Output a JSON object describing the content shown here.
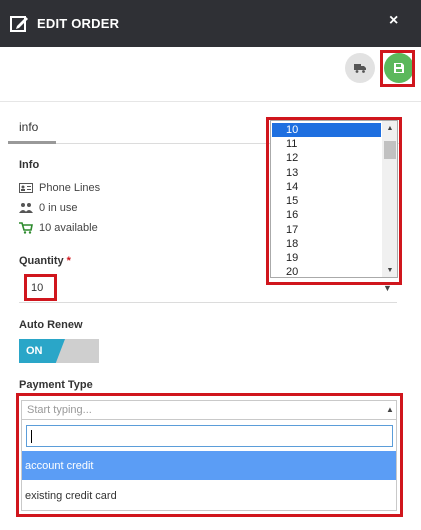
{
  "header": {
    "title": "EDIT ORDER",
    "close_icon": "×"
  },
  "toolbar": {
    "truck_button_icon": "truck-icon",
    "save_button_icon": "save-icon"
  },
  "tabs": [
    {
      "label": "info"
    }
  ],
  "info": {
    "title": "Info",
    "rows": [
      {
        "icon": "id-card-icon",
        "text": "Phone Lines"
      },
      {
        "icon": "users-icon",
        "text": "0 in use"
      },
      {
        "icon": "cart-icon",
        "text": "10 available"
      }
    ]
  },
  "quantity": {
    "label": "Quantity",
    "required_mark": "*",
    "value": "10",
    "options": [
      "10",
      "11",
      "12",
      "13",
      "14",
      "15",
      "16",
      "17",
      "18",
      "19",
      "20"
    ],
    "selected": "10"
  },
  "auto_renew": {
    "label": "Auto Renew",
    "state": "ON"
  },
  "payment_type": {
    "label": "Payment Type",
    "placeholder": "Start typing...",
    "search_value": "",
    "options": [
      "account credit",
      "existing credit card"
    ],
    "highlighted": "account credit"
  },
  "colors": {
    "header_bg": "#2f3035",
    "save_green": "#5cb85c",
    "toggle_on": "#2aa6c8",
    "highlight_red": "#d0161d",
    "option_selected": "#5b9df5"
  }
}
